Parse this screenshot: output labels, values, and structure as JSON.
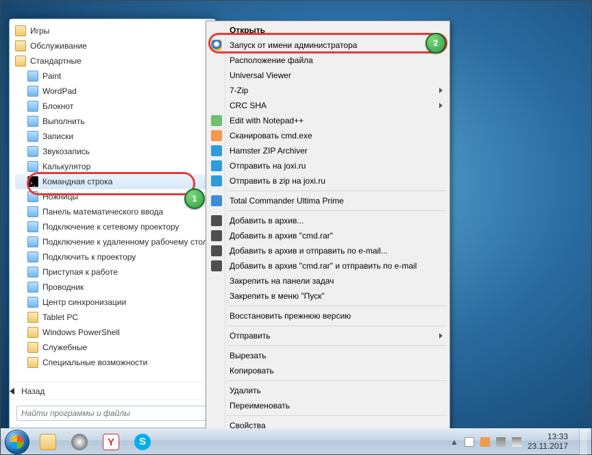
{
  "start_menu": {
    "folders_top": [
      "Игры",
      "Обслуживание",
      "Стандартные"
    ],
    "apps": [
      "Paint",
      "WordPad",
      "Блокнот",
      "Выполнить",
      "Записки",
      "Звукозапись",
      "Калькулятор",
      "Командная строка",
      "Ножницы",
      "Панель математического ввода",
      "Подключение к сетевому проектору",
      "Подключение к удаленному рабочему столу",
      "Подключить к проектору",
      "Приступая к работе",
      "Проводник",
      "Центр синхронизации"
    ],
    "subfolders": [
      "Tablet PC",
      "Windows PowerShell",
      "Служебные",
      "Специальные возможности"
    ],
    "selected_app_index": 7,
    "back_label": "Назад",
    "search_placeholder": "Найти программы и файлы"
  },
  "context_menu": {
    "items": [
      {
        "label": "Открыть",
        "bold": true
      },
      {
        "label": "Запуск от имени администратора",
        "icon": "shield"
      },
      {
        "label": "Расположение файла"
      },
      {
        "label": "Universal Viewer"
      },
      {
        "label": "7-Zip",
        "submenu": true
      },
      {
        "label": "CRC SHA",
        "submenu": true
      },
      {
        "label": "Edit with Notepad++",
        "icon": "green"
      },
      {
        "label": "Сканировать cmd.exe",
        "icon": "orange"
      },
      {
        "label": "Hamster ZIP Archiver",
        "icon": "teal"
      },
      {
        "label": "Отправить на joxi.ru",
        "icon": "teal"
      },
      {
        "label": "Отправить в zip на joxi.ru",
        "icon": "teal"
      },
      {
        "sep": true
      },
      {
        "label": "Total Commander Ultima Prime",
        "icon": "blue"
      },
      {
        "sep": true
      },
      {
        "label": "Добавить в архив...",
        "icon": "dark"
      },
      {
        "label": "Добавить в архив \"cmd.rar\"",
        "icon": "dark"
      },
      {
        "label": "Добавить в архив и отправить по e-mail...",
        "icon": "dark"
      },
      {
        "label": "Добавить в архив \"cmd.rar\" и отправить по e-mail",
        "icon": "dark"
      },
      {
        "label": "Закрепить на панели задач"
      },
      {
        "label": "Закрепить в меню \"Пуск\""
      },
      {
        "sep": true
      },
      {
        "label": "Восстановить прежнюю версию"
      },
      {
        "sep": true
      },
      {
        "label": "Отправить",
        "submenu": true
      },
      {
        "sep": true
      },
      {
        "label": "Вырезать"
      },
      {
        "label": "Копировать"
      },
      {
        "sep": true
      },
      {
        "label": "Удалить"
      },
      {
        "label": "Переименовать"
      },
      {
        "sep": true
      },
      {
        "label": "Свойства"
      }
    ]
  },
  "callouts": {
    "one": "1",
    "two": "2"
  },
  "taskbar": {
    "tray_icons": [
      "flag-icon",
      "battery-icon",
      "network-icon",
      "volume-icon"
    ],
    "time": "13:33",
    "date": "23.11.2017"
  }
}
